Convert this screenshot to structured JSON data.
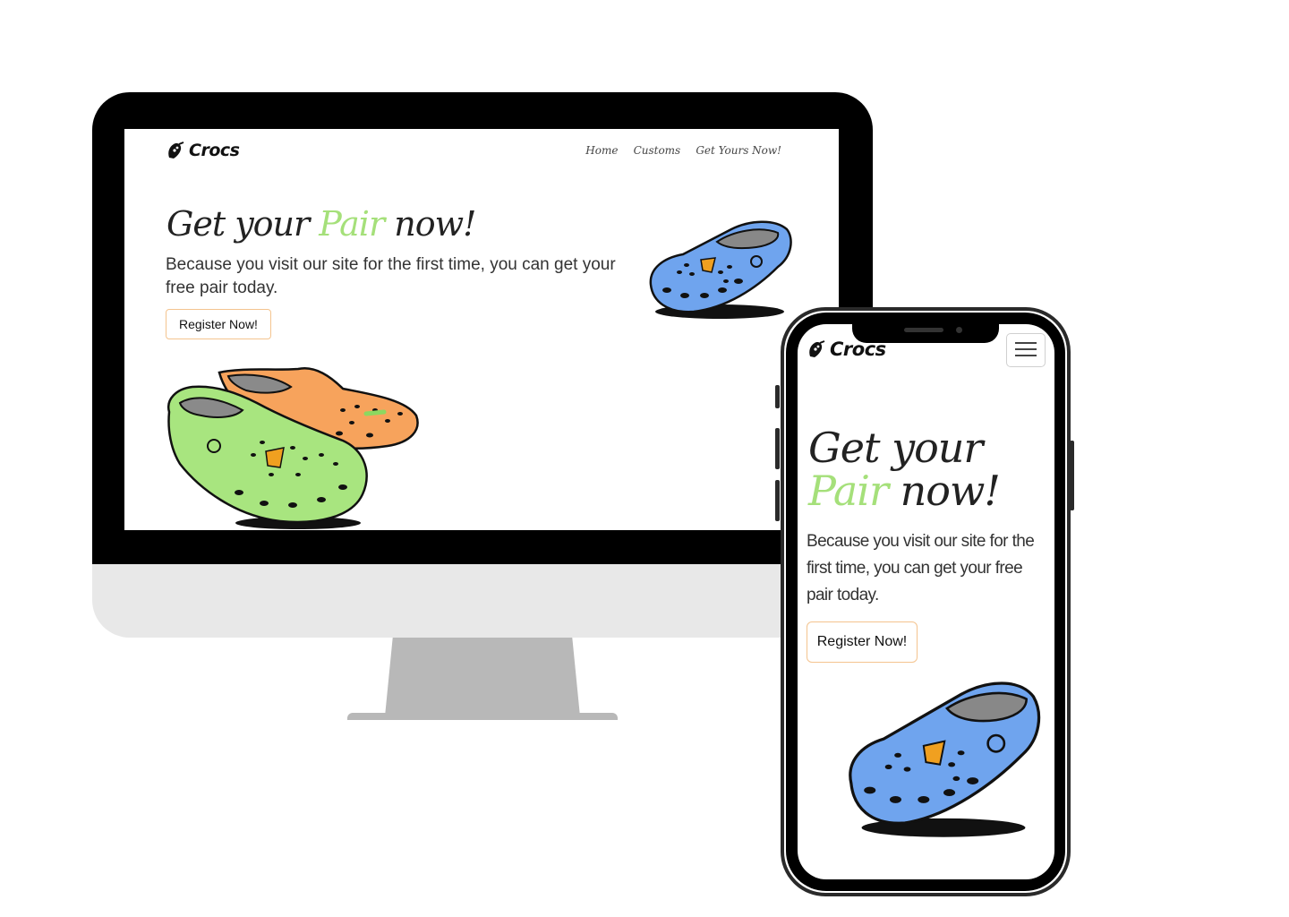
{
  "desktop": {
    "brand": "Crocs",
    "nav": [
      "Home",
      "Customs",
      "Get Yours Now!"
    ],
    "hero": {
      "title_before": "Get your",
      "title_accent": "Pair",
      "title_after": "now!",
      "subtitle": "Because you visit our site for the first time, you can get your free pair today.",
      "cta": "Register Now!"
    }
  },
  "mobile": {
    "brand": "Crocs",
    "hero": {
      "title_before": "Get your",
      "title_accent": "Pair",
      "title_after": "now!",
      "subtitle": "Because you visit our site for the first time, you can get your free pair today.",
      "cta": "Register Now!"
    }
  },
  "colors": {
    "accent_green": "#a5e07a",
    "button_border": "#f4c48f",
    "clog_blue": "#6fa4ee",
    "clog_green": "#a8e57f",
    "clog_orange": "#f7a35c"
  },
  "icons": [
    "crocs-logo-icon",
    "hamburger-menu-icon"
  ]
}
